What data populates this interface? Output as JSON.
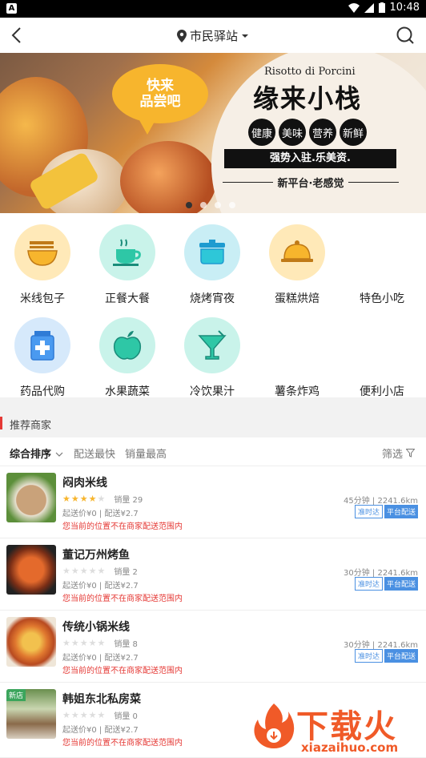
{
  "statusbar": {
    "time": "10:48"
  },
  "header": {
    "location": "市民驿站"
  },
  "banner": {
    "bubble_line1": "快来",
    "bubble_line2": "品尝吧",
    "en_title": "Risotto di Porcini",
    "title": "缘来小栈",
    "tags": [
      "健康",
      "美味",
      "营养",
      "新鲜"
    ],
    "slogan": "强势入驻.乐美资.",
    "sub": "新平台·老感觉",
    "pages": 4,
    "active_page": 0
  },
  "categories": [
    {
      "label": "米线包子",
      "icon": "noodle-bowl-icon",
      "color": "#ffe9b8"
    },
    {
      "label": "正餐大餐",
      "icon": "coffee-cup-icon",
      "color": "#c9f3ea"
    },
    {
      "label": "烧烤宵夜",
      "icon": "grill-pot-icon",
      "color": "#c9eef5"
    },
    {
      "label": "蛋糕烘焙",
      "icon": "cloche-icon",
      "color": "#ffe9b8"
    },
    {
      "label": "特色小吃",
      "icon": "",
      "color": ""
    },
    {
      "label": "药品代购",
      "icon": "medicine-box-icon",
      "color": "#d6e9fb"
    },
    {
      "label": "水果蔬菜",
      "icon": "apple-icon",
      "color": "#c9f3ea"
    },
    {
      "label": "冷饮果汁",
      "icon": "cocktail-icon",
      "color": "#c9f3ea"
    },
    {
      "label": "薯条炸鸡",
      "icon": "",
      "color": ""
    },
    {
      "label": "便利小店",
      "icon": "",
      "color": ""
    }
  ],
  "section": {
    "title": "推荐商家"
  },
  "sort": {
    "tabs": [
      "综合排序",
      "配送最快",
      "销量最高"
    ],
    "filter": "筛选"
  },
  "shops": [
    {
      "name": "闷肉米线",
      "stars": 4,
      "sales": "销量 29",
      "fee": "起送价¥0 | 配送¥2.7",
      "warn": "您当前的位置不在商家配送范围内",
      "eta": "45分钟 | 2241.6km",
      "badge1": "准时达",
      "badge2": "平台配送",
      "is_new": false,
      "new_label": ""
    },
    {
      "name": "董记万州烤鱼",
      "stars": 0,
      "sales": "销量 2",
      "fee": "起送价¥0 | 配送¥2.7",
      "warn": "您当前的位置不在商家配送范围内",
      "eta": "30分钟 | 2241.6km",
      "badge1": "准时达",
      "badge2": "平台配送",
      "is_new": false,
      "new_label": ""
    },
    {
      "name": "传统小锅米线",
      "stars": 0,
      "sales": "销量 8",
      "fee": "起送价¥0 | 配送¥2.7",
      "warn": "您当前的位置不在商家配送范围内",
      "eta": "30分钟 | 2241.6km",
      "badge1": "准时达",
      "badge2": "平台配送",
      "is_new": false,
      "new_label": ""
    },
    {
      "name": "韩姐东北私房菜",
      "stars": 0,
      "sales": "销量 0",
      "fee": "起送价¥0 | 配送¥2.7",
      "warn": "您当前的位置不在商家配送范围内",
      "eta": "",
      "badge1": "",
      "badge2": "",
      "is_new": true,
      "new_label": "新店"
    }
  ],
  "watermark": {
    "brand": "下载火",
    "domain": "xiazaihuo.com"
  }
}
